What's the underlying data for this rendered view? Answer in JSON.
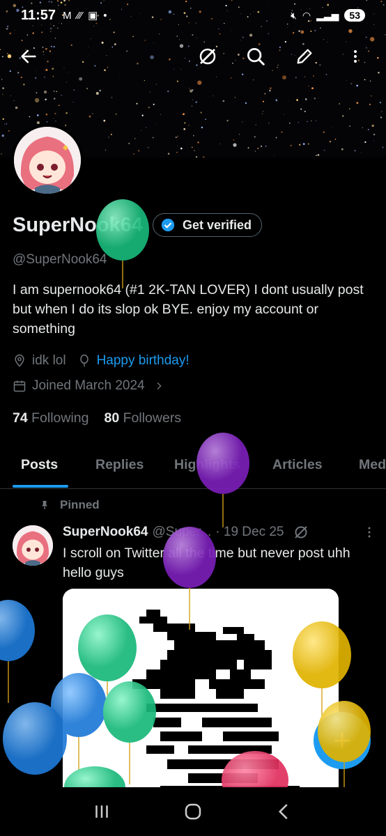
{
  "status_bar": {
    "time": "11:57",
    "battery": "53"
  },
  "profile": {
    "display_name": "SuperNook64",
    "get_verified_label": "Get verified",
    "handle": "@SuperNook64",
    "bio": "I am supernook64 (#1 2K-TAN LOVER) I dont usually post but when I do its slop ok BYE. enjoy my account or something",
    "location": "idk lol",
    "birthday": "Happy birthday!",
    "joined": "Joined March 2024",
    "following_count": "74",
    "following_label": "Following",
    "followers_count": "80",
    "followers_label": "Followers"
  },
  "tabs": [
    {
      "label": "Posts",
      "active": true
    },
    {
      "label": "Replies"
    },
    {
      "label": "Highlights"
    },
    {
      "label": "Articles"
    },
    {
      "label": "Media"
    }
  ],
  "pinned_tweet": {
    "pinned_label": "Pinned",
    "author_name": "SuperNook64",
    "author_handle": "@Super...",
    "date": "· 19 Dec 25",
    "text": "I scroll on Twitter all the time but never post uhh hello guys"
  },
  "icons": {
    "back": "arrow-left-icon",
    "grok": "grok-icon",
    "search": "search-icon",
    "edit": "pencil-icon",
    "more": "more-vertical-icon",
    "compose": "plus-icon"
  },
  "colors": {
    "accent": "#1d9bf0",
    "background": "#000000",
    "text": "#e7e9ea",
    "muted": "#71767b"
  }
}
